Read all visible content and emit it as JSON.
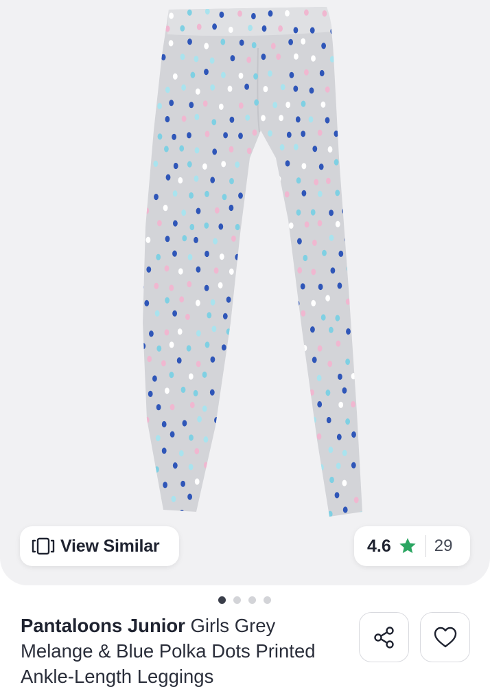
{
  "product": {
    "brand": "Pantaloons Junior",
    "title_rest": "Girls Grey Melange & Blue Polka Dots Printed Ankle-Length Leggings"
  },
  "actions": {
    "view_similar_label": "View Similar"
  },
  "rating": {
    "value": "4.6",
    "count": "29",
    "star_color": "#2aa561"
  },
  "carousel": {
    "total": 4,
    "active_index": 0
  },
  "icons": {
    "view_similar": "view-similar-icon",
    "star": "star-icon",
    "share": "share-icon",
    "wishlist": "heart-icon"
  }
}
